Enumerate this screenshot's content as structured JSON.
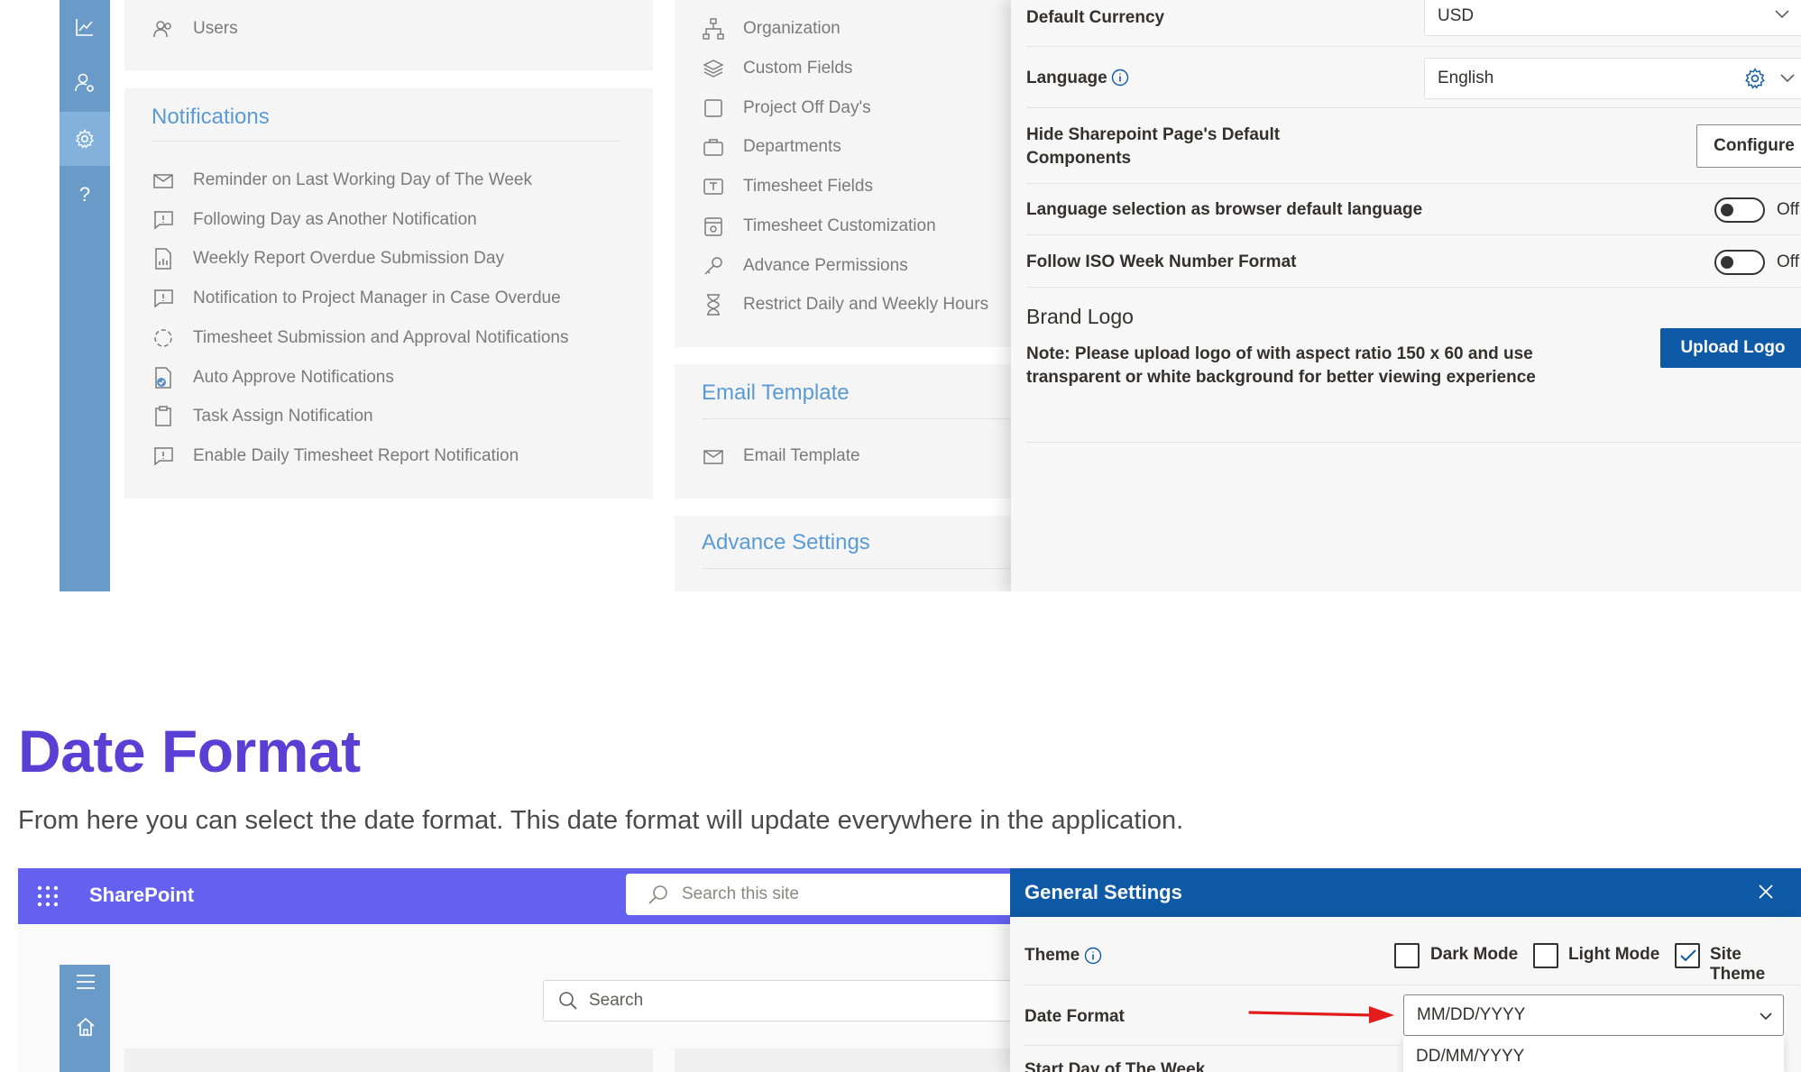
{
  "top": {
    "rail_icons": [
      "chart-icon",
      "user-settings-icon",
      "gear-icon",
      "help-icon"
    ],
    "users_label": "Users",
    "notifications": {
      "heading": "Notifications",
      "items": [
        "Reminder on Last Working Day of The Week",
        "Following Day as Another Notification",
        "Weekly Report Overdue Submission Day",
        "Notification to Project Manager in Case Overdue",
        "Timesheet Submission and Approval Notifications",
        "Auto Approve Notifications",
        "Task Assign Notification",
        "Enable Daily Timesheet Report Notification"
      ]
    },
    "org_items": [
      "Organization",
      "Custom Fields",
      "Project Off Day's",
      "Departments",
      "Timesheet Fields",
      "Timesheet Customization",
      "Advance Permissions",
      "Restrict Daily and Weekly Hours"
    ],
    "email_template": {
      "heading": "Email Template",
      "item": "Email Template"
    },
    "advance_settings_heading": "Advance Settings",
    "settings": {
      "default_currency_label": "Default Currency",
      "default_currency_value": "USD",
      "language_label": "Language",
      "language_value": "English",
      "hide_components_label_line1": "Hide Sharepoint Page's Default",
      "hide_components_label_line2": "Components",
      "configure_button": "Configure",
      "browser_language_label": "Language selection as browser default language",
      "browser_language_state": "Off",
      "iso_week_label": "Follow ISO Week Number Format",
      "iso_week_state": "Off",
      "brand_logo_heading": "Brand Logo",
      "brand_logo_note_line1": "Note: Please upload logo of with aspect ratio 150 x 60 and use",
      "brand_logo_note_line2": "transparent or white background for better viewing experience",
      "upload_logo_button": "Upload Logo"
    }
  },
  "article": {
    "title": "Date Format",
    "description": "From here you can select the date format. This date format will update everywhere in the application."
  },
  "bottom": {
    "app_name": "SharePoint",
    "site_search_placeholder": "Search this site",
    "inner_search_placeholder": "Search",
    "general_settings": {
      "title": "General Settings",
      "theme_label": "Theme",
      "theme_options": [
        {
          "label": "Dark Mode",
          "checked": false
        },
        {
          "label": "Light Mode",
          "checked": false
        },
        {
          "label": "Site Theme",
          "checked": true
        }
      ],
      "date_format_label": "Date Format",
      "date_format_value": "MM/DD/YYYY",
      "date_format_option": "DD/MM/YYYY",
      "start_day_label": "Start Day of The Week"
    }
  },
  "colors": {
    "accent_purple": "#5a3fd4",
    "sharepoint_bar": "#6461f0",
    "primary_blue": "#0f5aa6",
    "rail_blue": "#6a9bc8",
    "annotation_arrow": "#e21b1b"
  }
}
